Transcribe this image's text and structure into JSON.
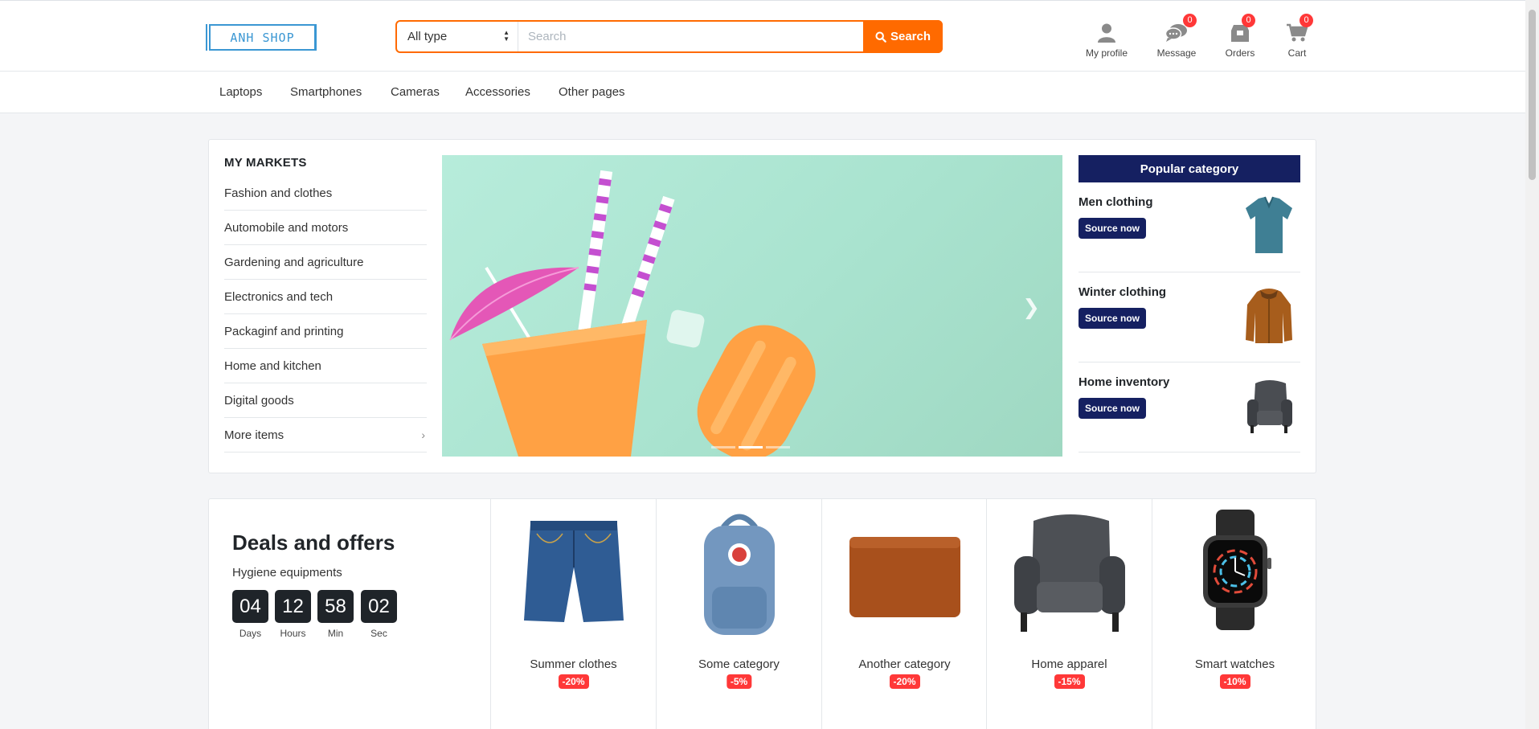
{
  "header": {
    "logo": "ANH SHOP",
    "type_select": "All type",
    "search_placeholder": "Search",
    "search_button": "Search",
    "icons": [
      {
        "label": "My profile",
        "icon": "user-icon"
      },
      {
        "label": "Message",
        "icon": "message-icon",
        "badge": "0"
      },
      {
        "label": "Orders",
        "icon": "orders-icon",
        "badge": "0"
      },
      {
        "label": "Cart",
        "icon": "cart-icon",
        "badge": "0"
      }
    ]
  },
  "nav": [
    "Laptops",
    "Smartphones",
    "Cameras",
    "Accessories",
    "Other pages"
  ],
  "markets": {
    "title": "MY MARKETS",
    "items": [
      "Fashion and clothes",
      "Automobile and motors",
      "Gardening and agriculture",
      "Electronics and tech",
      "Packaginf and printing",
      "Home and kitchen",
      "Digital goods",
      "More items"
    ]
  },
  "popular": {
    "title": "Popular category",
    "items": [
      {
        "name": "Men clothing",
        "button": "Source now"
      },
      {
        "name": "Winter clothing",
        "button": "Source now"
      },
      {
        "name": "Home inventory",
        "button": "Source now"
      }
    ]
  },
  "deals": {
    "title": "Deals and offers",
    "subtitle": "Hygiene equipments",
    "countdown": [
      {
        "value": "04",
        "unit": "Days"
      },
      {
        "value": "12",
        "unit": "Hours"
      },
      {
        "value": "58",
        "unit": "Min"
      },
      {
        "value": "02",
        "unit": "Sec"
      }
    ],
    "products": [
      {
        "name": "Summer clothes",
        "discount": "-20%"
      },
      {
        "name": "Some category",
        "discount": "-5%"
      },
      {
        "name": "Another category",
        "discount": "-20%"
      },
      {
        "name": "Home apparel",
        "discount": "-15%"
      },
      {
        "name": "Smart watches",
        "discount": "-10%"
      }
    ]
  },
  "colors": {
    "accent": "#ff6a00",
    "navy": "#152061",
    "badge": "#ff3838",
    "logo": "#3b97d3"
  }
}
